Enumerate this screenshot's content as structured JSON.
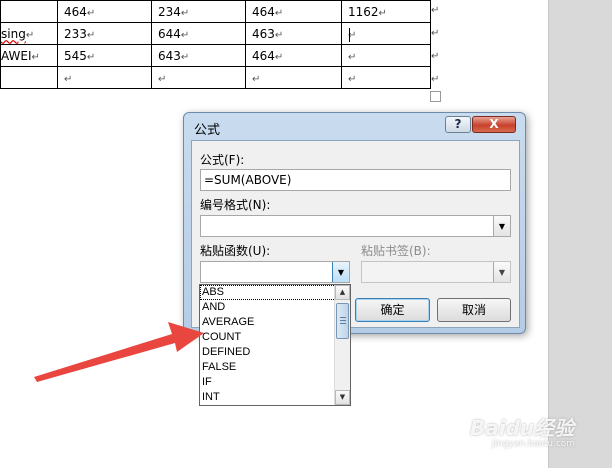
{
  "document": {
    "rows": [
      {
        "cells": [
          "",
          "464",
          "234",
          "464",
          "1162"
        ]
      },
      {
        "cells": [
          "sing",
          "233",
          "644",
          "463",
          ""
        ]
      },
      {
        "cells": [
          "AWEI",
          "545",
          "643",
          "464",
          ""
        ]
      },
      {
        "cells": [
          "",
          "",
          "",
          "",
          ""
        ]
      }
    ],
    "mark": "↵"
  },
  "dialog": {
    "title": "公式",
    "help_label": "?",
    "close_label": "X",
    "formula_label": "公式(F):",
    "formula_value": "=SUM(ABOVE)",
    "number_format_label": "编号格式(N):",
    "number_format_value": "",
    "paste_function_label": "粘贴函数(U):",
    "paste_function_value": "",
    "paste_bookmark_label": "粘贴书签(B):",
    "ok_label": "确定",
    "cancel_label": "取消",
    "function_list": [
      "ABS",
      "AND",
      "AVERAGE",
      "COUNT",
      "DEFINED",
      "FALSE",
      "IF",
      "INT"
    ]
  },
  "colors": {
    "arrow": "#e8463f",
    "dialog_frame": "#b4cce6",
    "close_button": "#c8412c"
  },
  "watermark": {
    "main": "Baidu经验",
    "sub": "jingyan.baidu.com"
  }
}
